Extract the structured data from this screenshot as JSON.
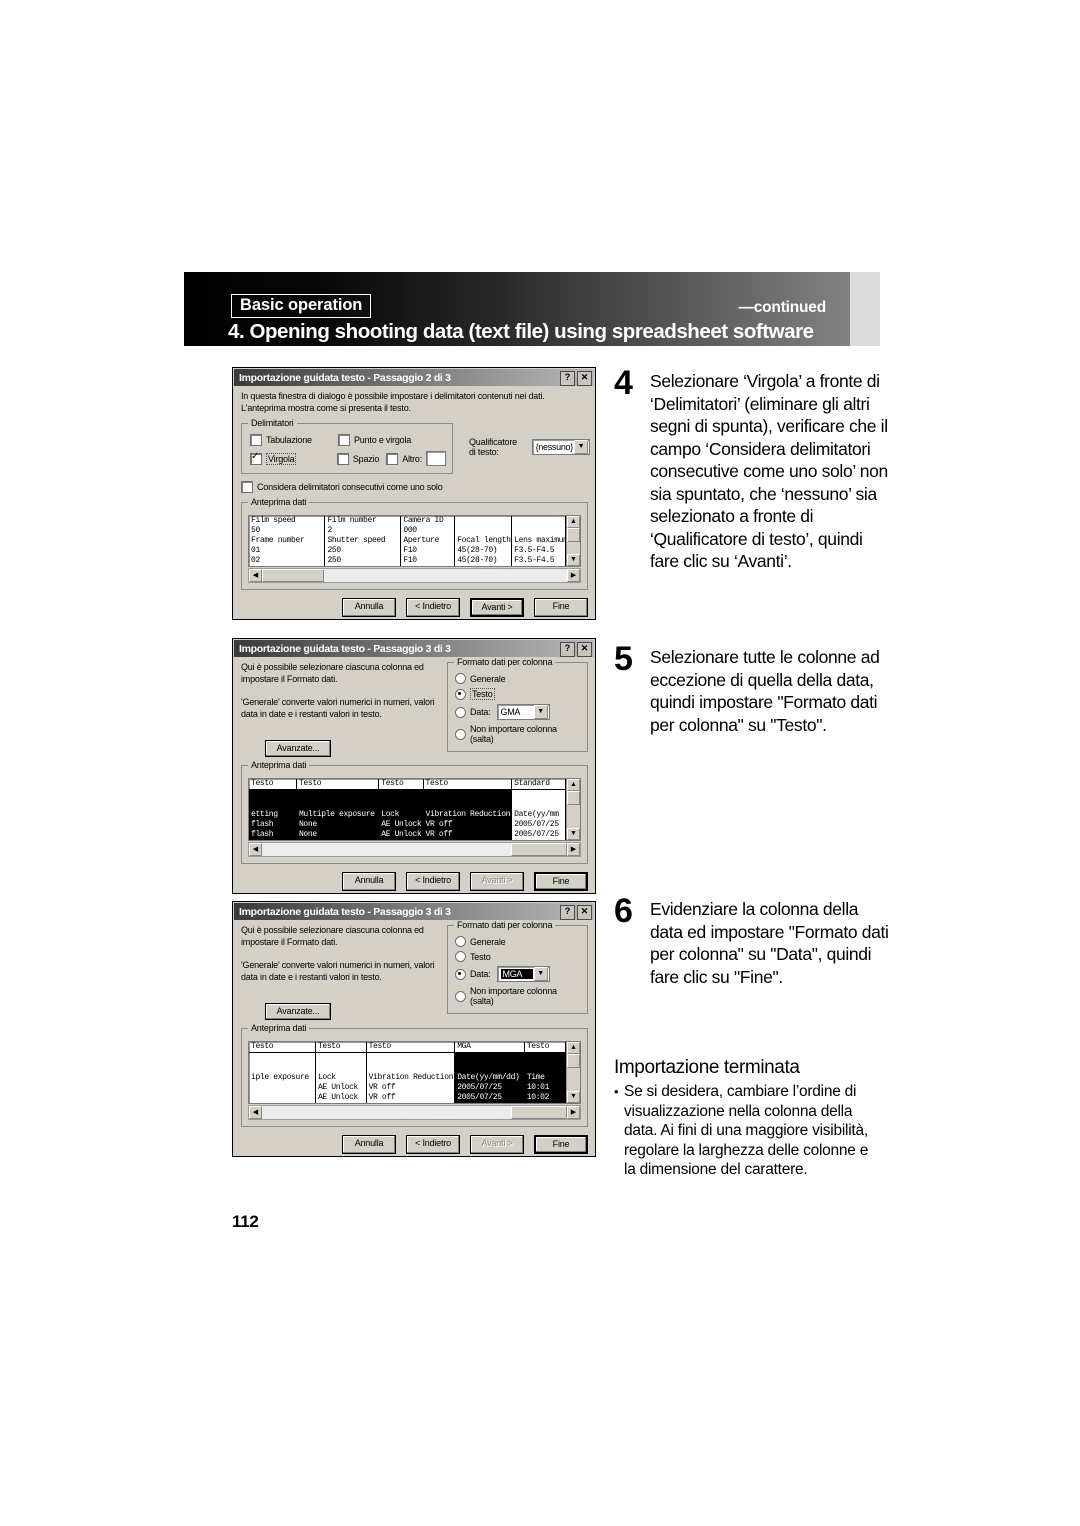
{
  "header": {
    "badge": "Basic operation",
    "continued": "—continued",
    "title": "4. Opening shooting data (text file) using spreadsheet software"
  },
  "page_number": "112",
  "dialogs": [
    {
      "title": "Importazione guidata testo - Passaggio 2 di 3",
      "titlebar_buttons": {
        "help": "?",
        "close": "✕"
      },
      "intro_line1": "In questa finestra di dialogo è possibile impostare i delimitatori contenuti nei dati.",
      "intro_line2": "L'anteprima mostra come si presenta il testo.",
      "delimiters_group": {
        "legend": "Delimitatori",
        "checkboxes": [
          {
            "label": "Tabulazione",
            "checked": false
          },
          {
            "label": "Punto e virgola",
            "checked": false
          },
          {
            "label": "Virgola",
            "checked": true,
            "focused": true
          },
          {
            "label": "Spazio",
            "checked": false
          },
          {
            "label": "Altro:",
            "checked": false,
            "has_textbox": true
          }
        ]
      },
      "qualifier": {
        "label": "Qualificatore di testo:",
        "value": "{nessuno}"
      },
      "consecutive": {
        "label": "Considera delimitatori consecutivi come uno solo",
        "checked": false
      },
      "preview": {
        "legend": "Anteprima dati",
        "headers": [
          "",
          "",
          "",
          "",
          ""
        ],
        "rows": [
          [
            "Film speed",
            "Film number",
            "Camera ID",
            "",
            ""
          ],
          [
            "50",
            "2",
            "000",
            "",
            ""
          ],
          [
            "Frame number",
            "Shutter speed",
            "Aperture",
            "Focal length",
            "Lens maximum ap"
          ],
          [
            "01",
            "250",
            "F10",
            "45(28-70)",
            "F3.5-F4.5"
          ],
          [
            "02",
            "250",
            "F10",
            "45(28-70)",
            "F3.5-F4.5"
          ]
        ],
        "selected_columns": []
      },
      "buttons": [
        {
          "label": "Annulla",
          "state": "normal"
        },
        {
          "label": "< Indietro",
          "state": "normal"
        },
        {
          "label": "Avanti >",
          "state": "default"
        },
        {
          "label": "Fine",
          "state": "normal"
        }
      ]
    },
    {
      "title": "Importazione guidata testo - Passaggio 3 di 3",
      "titlebar_buttons": {
        "help": "?",
        "close": "✕"
      },
      "intro_line1": "Qui è possibile selezionare ciascuna colonna ed",
      "intro_line2": "impostare il Formato dati.",
      "intro_line3": "'Generale' converte valori numerici in numeri, valori",
      "intro_line4": "data in date e i restanti valori in testo.",
      "advanced_button": "Avanzate...",
      "format_group": {
        "legend": "Formato dati per colonna",
        "radios": [
          {
            "label": "Generale",
            "selected": false
          },
          {
            "label": "Testo",
            "selected": true,
            "focused": true
          },
          {
            "label": "Data:",
            "selected": false,
            "combo": "GMA",
            "combo_selected": false
          },
          {
            "label": "Non importare colonna (salta)",
            "selected": false
          }
        ]
      },
      "preview": {
        "legend": "Anteprima dati",
        "headers": [
          "Testo",
          "Testo",
          "Testo",
          "Testo",
          "Standard"
        ],
        "rows": [
          [
            "",
            "",
            "",
            "",
            ""
          ],
          [
            "",
            "",
            "",
            "",
            ""
          ],
          [
            "etting",
            "Multiple exposure",
            "Lock",
            "Vibration Reduction",
            "Date(yy/mm"
          ],
          [
            "flash",
            "None",
            "AE Unlock",
            "VR off",
            "2005/07/25"
          ],
          [
            "flash",
            "None",
            "AE Unlock",
            "VR off",
            "2005/07/25"
          ]
        ],
        "selected_columns": [
          0,
          1,
          2,
          3
        ]
      },
      "buttons": [
        {
          "label": "Annulla",
          "state": "normal"
        },
        {
          "label": "< Indietro",
          "state": "normal"
        },
        {
          "label": "Avanti >",
          "state": "disabled"
        },
        {
          "label": "Fine",
          "state": "default"
        }
      ]
    },
    {
      "title": "Importazione guidata testo - Passaggio 3 di 3",
      "titlebar_buttons": {
        "help": "?",
        "close": "✕"
      },
      "intro_line1": "Qui è possibile selezionare ciascuna colonna ed",
      "intro_line2": "impostare il Formato dati.",
      "intro_line3": "'Generale' converte valori numerici in numeri, valori",
      "intro_line4": "data in date e i restanti valori in testo.",
      "advanced_button": "Avanzate...",
      "format_group": {
        "legend": "Formato dati per colonna",
        "radios": [
          {
            "label": "Generale",
            "selected": false
          },
          {
            "label": "Testo",
            "selected": false
          },
          {
            "label": "Data:",
            "selected": true,
            "combo": "MGA",
            "combo_selected": true
          },
          {
            "label": "Non importare colonna (salta)",
            "selected": false
          }
        ]
      },
      "preview": {
        "legend": "Anteprima dati",
        "headers": [
          "Testo",
          "Testo",
          "Testo",
          "MGA",
          "Testo"
        ],
        "rows": [
          [
            "",
            "",
            "",
            "",
            ""
          ],
          [
            "",
            "",
            "",
            "",
            ""
          ],
          [
            "iple exposure",
            "Lock",
            "Vibration Reduction",
            "Date(yy/mm/dd)",
            "Time"
          ],
          [
            "",
            "AE Unlock",
            "VR off",
            "2005/07/25",
            "10:01"
          ],
          [
            "",
            "AE Unlock",
            "VR off",
            "2005/07/25",
            "10:02"
          ]
        ],
        "selected_columns": [
          3
        ]
      },
      "buttons": [
        {
          "label": "Annulla",
          "state": "normal"
        },
        {
          "label": "< Indietro",
          "state": "normal"
        },
        {
          "label": "Avanti >",
          "state": "disabled"
        },
        {
          "label": "Fine",
          "state": "default"
        }
      ]
    }
  ],
  "steps": [
    {
      "number": "4",
      "text": "Selezionare ‘Virgola’ a fronte di ‘Delimitatori’ (eliminare gli altri segni di spunta), verificare che il campo ‘Considera delimitatori consecutive come uno solo’ non sia spuntato, che ‘nessuno’ sia selezionato a fronte di ‘Qualificatore di testo’, quindi fare clic su ‘Avanti’."
    },
    {
      "number": "5",
      "text": "Selezionare tutte le colonne ad eccezione di quella della data, quindi impostare \"Formato dati per colonna\" su \"Testo\"."
    },
    {
      "number": "6",
      "text": "Evidenziare la colonna della data ed impostare \"Formato dati per colonna\" su \"Data\", quindi fare clic su \"Fine\"."
    }
  ],
  "finish": {
    "heading": "Importazione terminata",
    "bullet": "•",
    "note": "Se si desidera, cambiare l’ordine di visualizzazione nella colonna della data. Ai fini di una maggiore visibilità, regolare la larghezza delle colonne e la dimensione del carattere."
  }
}
